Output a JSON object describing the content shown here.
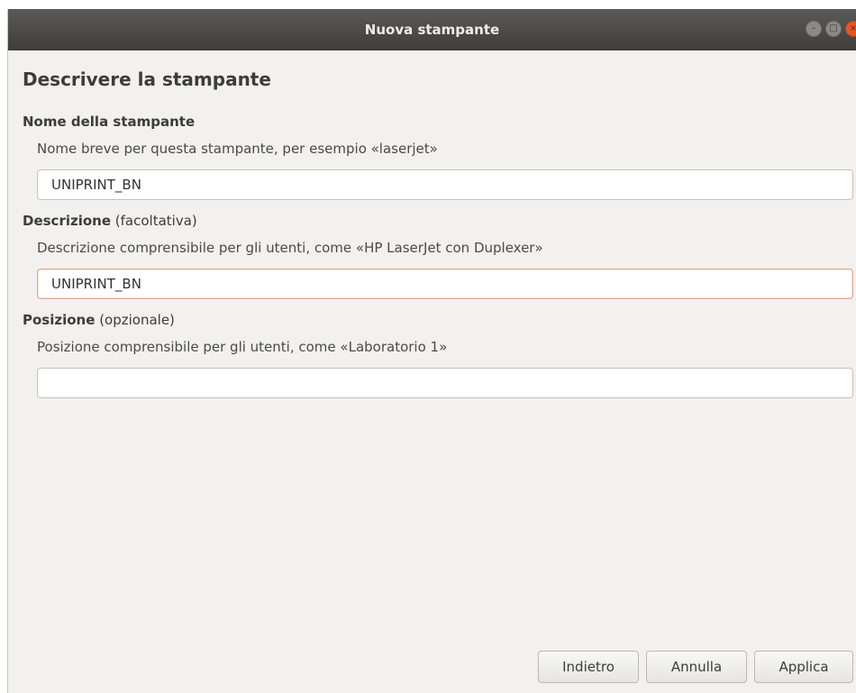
{
  "window": {
    "title": "Nuova stampante"
  },
  "page": {
    "title": "Descrivere la stampante"
  },
  "printer_name": {
    "label": "Nome della stampante",
    "help": "Nome breve per questa stampante, per esempio «laserjet»",
    "value": "UNIPRINT_BN"
  },
  "description": {
    "label": "Descrizione",
    "qualifier": "(facoltativa)",
    "help": "Descrizione comprensibile per gli utenti, come «HP LaserJet con Duplexer»",
    "value": "UNIPRINT_BN"
  },
  "location": {
    "label": "Posizione",
    "qualifier": "(opzionale)",
    "help": "Posizione comprensibile per gli utenti, come «Laboratorio 1»",
    "value": ""
  },
  "buttons": {
    "back": "Indietro",
    "cancel": "Annulla",
    "apply": "Applica"
  },
  "colors": {
    "titlebar": "#3e3d39",
    "close_button": "#e95420",
    "focus_border": "#e9a48a"
  }
}
